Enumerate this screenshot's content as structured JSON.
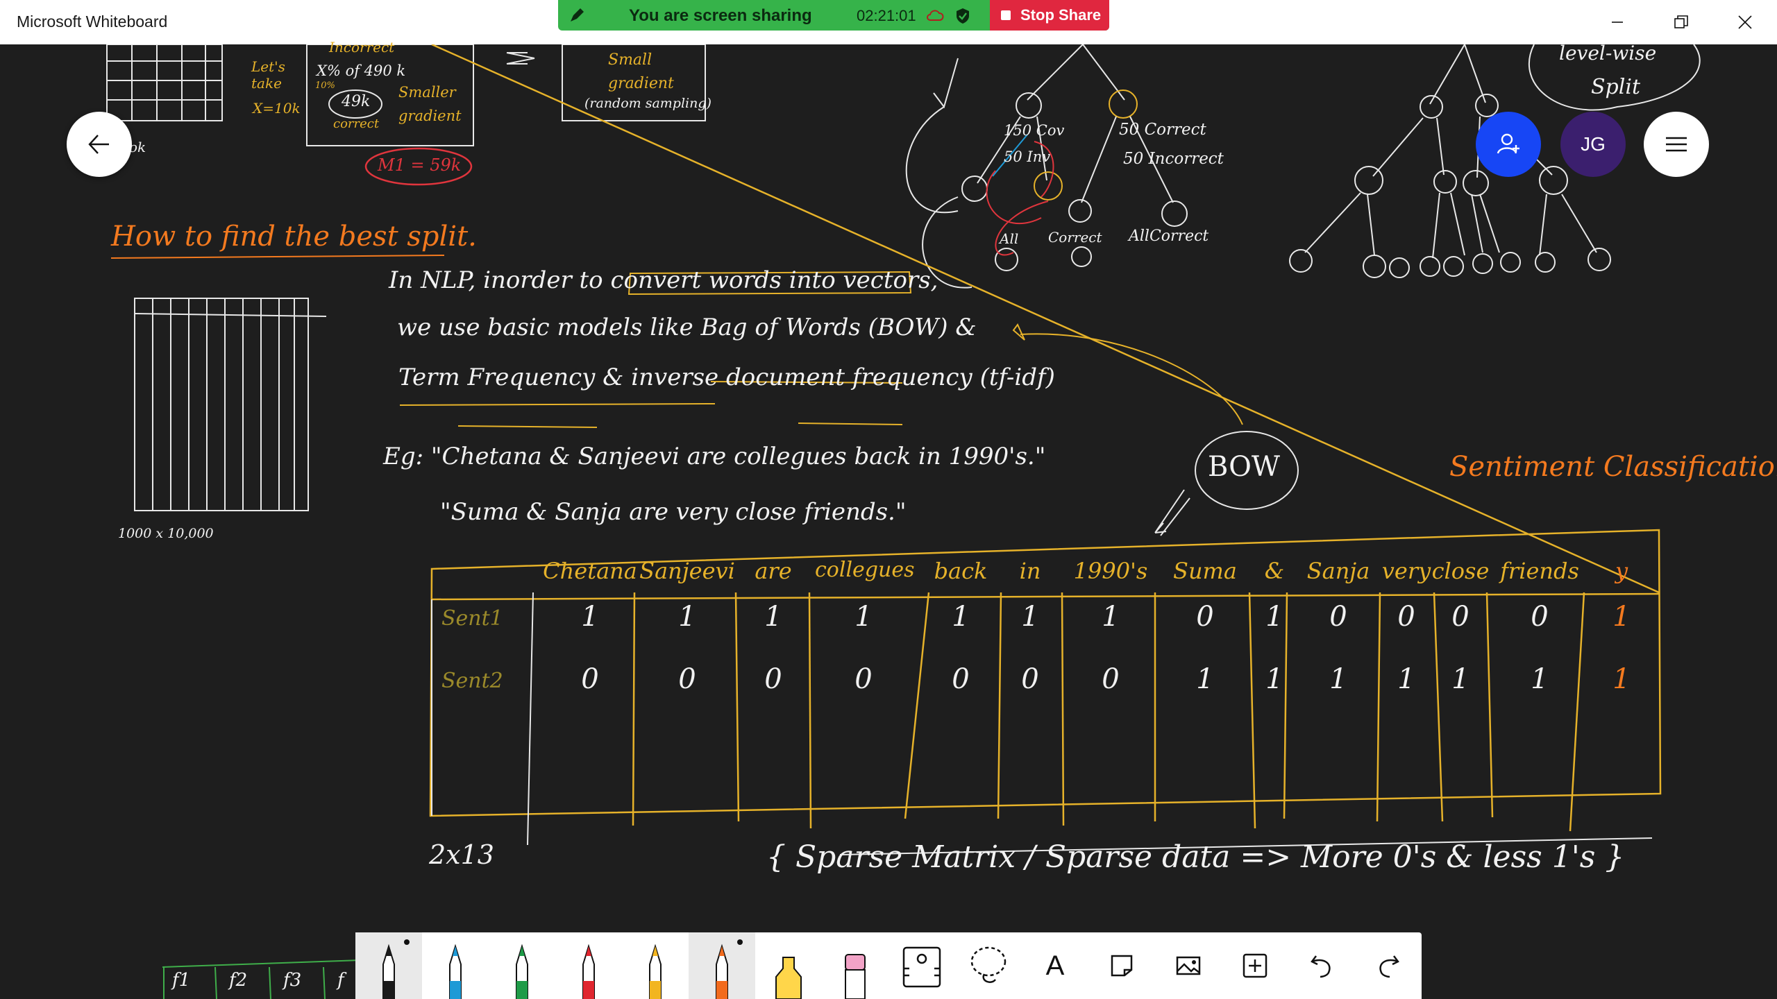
{
  "window": {
    "title": "Microsoft Whiteboard"
  },
  "share_bar": {
    "status": "You are screen sharing",
    "timer": "02:21:01",
    "stop_label": "Stop Share",
    "color": "#36b34a",
    "stop_color": "#e0273f"
  },
  "controls": {
    "avatar_initials": "JG",
    "back_icon": "arrow-left-icon",
    "invite_icon": "person-add-icon",
    "menu_icon": "hamburger-icon",
    "invite_color": "#1746f5",
    "avatar_color": "#3b1f6e"
  },
  "board": {
    "notes_top": {
      "lets_take": "Let's take",
      "x_10k": "X=10k",
      "incorrect": "Incorrect",
      "percent_of": "X% of 490 k",
      "percent_small": "10%",
      "k49": "49k",
      "correct": "correct",
      "smaller_gradient": "Smaller gradient",
      "small_gradient": "Small gradient",
      "random_sampling": "(random sampling)",
      "m_value": "M1 = 59k",
      "ok": "ok",
      "cov": "150 Cov",
      "inv": "50 Inv",
      "correct_50": "50 Correct",
      "incorrect_50": "50 Incorrect",
      "all": "All",
      "correct_leaf": "Correct",
      "all_correct": "AllCorrect",
      "level_wise": "level-wise",
      "split": "Split"
    },
    "heading": "How to find the best split.",
    "grid_label": "1000 x 10,000",
    "lines": [
      "In NLP, inorder to convert words into vectors,",
      "we use basic models like Bag of Words (BOW) &",
      "Term Frequency & inverse document frequency (tf-idf)",
      "Eg: \"Chetana & Sanjeevi are collegues back in 1990's.\"",
      "\"Suma & Sanja are very close friends.\""
    ],
    "bow_bubble": "BOW",
    "sentiment": "Sentiment Classification",
    "dimension_note": "2x13",
    "sparse_note": "{ Sparse Matrix / Sparse data => More 0's & less 1's }",
    "bottom_partial": [
      "f1",
      "f2",
      "f3",
      "f"
    ]
  },
  "table": {
    "columns": [
      "Chetana",
      "Sanjeevi",
      "are",
      "collegues",
      "back",
      "in",
      "1990's",
      "Suma",
      "&",
      "Sanja",
      "very",
      "close",
      "friends",
      "y"
    ],
    "rows": [
      {
        "label": "Sent1",
        "values": [
          "1",
          "1",
          "1",
          "1",
          "1",
          "1",
          "1",
          "0",
          "1",
          "0",
          "0",
          "0",
          "0",
          "1"
        ]
      },
      {
        "label": "Sent2",
        "values": [
          "0",
          "0",
          "0",
          "0",
          "0",
          "0",
          "0",
          "1",
          "1",
          "1",
          "1",
          "1",
          "1",
          "1"
        ]
      }
    ]
  },
  "toolbar": {
    "tools": [
      {
        "name": "pen-black",
        "color": "#1a1a1a",
        "active": true
      },
      {
        "name": "pen-blue",
        "color": "#1e9ad6",
        "active": false
      },
      {
        "name": "pen-green",
        "color": "#1f9b48",
        "active": false
      },
      {
        "name": "pen-red",
        "color": "#e0262f",
        "active": false
      },
      {
        "name": "pen-yellow",
        "color": "#f2b520",
        "active": false
      },
      {
        "name": "pen-orange",
        "color": "#f26b1d",
        "active": true
      },
      {
        "name": "highlighter-yellow",
        "color": "#ffd64a",
        "active": false
      },
      {
        "name": "eraser",
        "color": "#f2a3c7",
        "active": false
      }
    ],
    "icons": [
      "ruler-icon",
      "lasso-icon",
      "text-icon",
      "note-icon",
      "image-icon",
      "insert-icon",
      "undo-icon",
      "redo-icon"
    ],
    "text_tool_label": "A"
  }
}
